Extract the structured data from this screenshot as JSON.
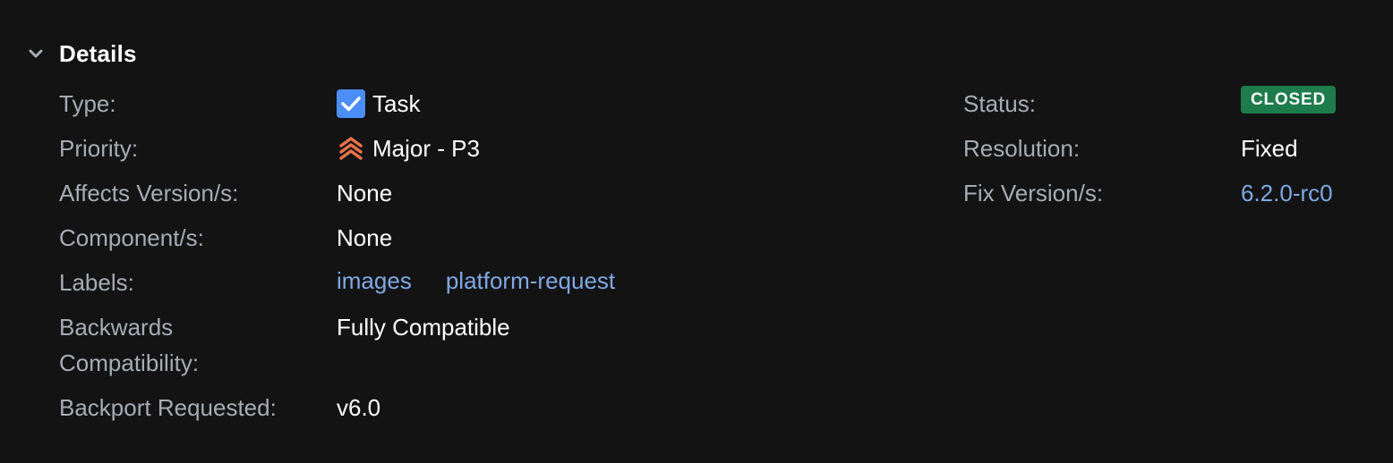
{
  "section": {
    "title": "Details",
    "collapse_icon": "chevron-down-icon"
  },
  "left_fields": {
    "type": {
      "label": "Type:",
      "value": "Task",
      "icon": "task-checkbox-icon",
      "icon_color": "#4c8ef7"
    },
    "priority": {
      "label": "Priority:",
      "value": "Major - P3",
      "icon": "priority-major-icon",
      "icon_color": "#e8734a"
    },
    "affects_version": {
      "label": "Affects Version/s:",
      "value": "None"
    },
    "components": {
      "label": "Component/s:",
      "value": "None"
    },
    "labels": {
      "label": "Labels:",
      "items": [
        "images",
        "platform-request"
      ]
    },
    "backwards_compat": {
      "label_line1": "Backwards",
      "label_line2": "Compatibility:",
      "value": "Fully Compatible"
    },
    "backport": {
      "label": "Backport Requested:",
      "value": "v6.0"
    }
  },
  "right_fields": {
    "status": {
      "label": "Status:",
      "value": "CLOSED",
      "badge_color": "#1e7b4c"
    },
    "resolution": {
      "label": "Resolution:",
      "value": "Fixed"
    },
    "fix_version": {
      "label": "Fix Version/s:",
      "value": "6.2.0-rc0"
    }
  },
  "colors": {
    "background": "#131314",
    "label_text": "#a7acb3",
    "value_text": "#ffffff",
    "link_text": "#7fa9e2"
  }
}
